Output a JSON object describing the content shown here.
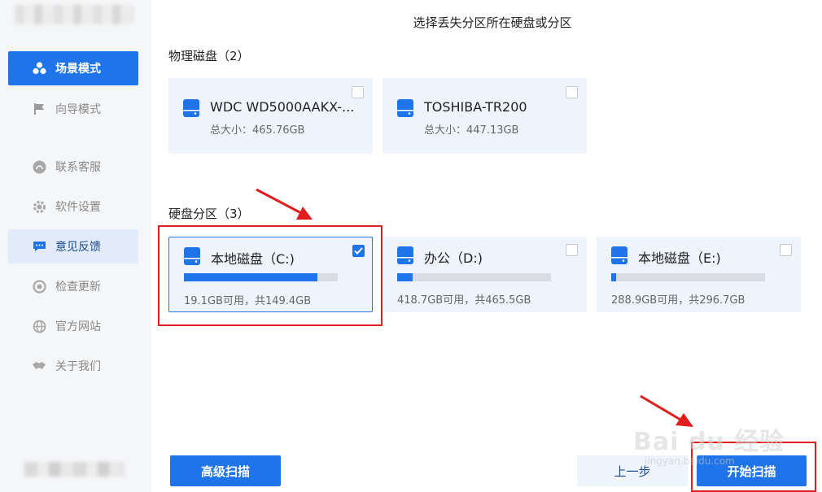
{
  "sidebar": {
    "items": [
      {
        "label": "场景模式",
        "icon": "scene-icon"
      },
      {
        "label": "向导模式",
        "icon": "flag-icon"
      },
      {
        "label": "联系客服",
        "icon": "headset-icon"
      },
      {
        "label": "软件设置",
        "icon": "gear-icon"
      },
      {
        "label": "意见反馈",
        "icon": "chat-icon"
      },
      {
        "label": "检查更新",
        "icon": "update-icon"
      },
      {
        "label": "官方网站",
        "icon": "globe-icon"
      },
      {
        "label": "关于我们",
        "icon": "handshake-icon"
      }
    ]
  },
  "main": {
    "title": "选择丢失分区所在硬盘或分区",
    "physical_section": "物理磁盘（2）",
    "physical_disks": [
      {
        "name": "WDC WD5000AAKX-...",
        "size": "总大小：465.76GB",
        "checked": false
      },
      {
        "name": "TOSHIBA-TR200",
        "size": "总大小：447.13GB",
        "checked": false
      }
    ],
    "partition_section": "硬盘分区（3）",
    "partitions": [
      {
        "name": "本地磁盘（C:)",
        "usage": "19.1GB可用，共149.4GB",
        "used_fraction": 0.87,
        "checked": true
      },
      {
        "name": "办公（D:)",
        "usage": "418.7GB可用，共465.5GB",
        "used_fraction": 0.1,
        "checked": false
      },
      {
        "name": "本地磁盘（E:)",
        "usage": "288.9GB可用，共296.7GB",
        "used_fraction": 0.03,
        "checked": false
      }
    ]
  },
  "footer": {
    "advanced_scan": "高级扫描",
    "prev_step": "上一步",
    "start_scan": "开始扫描"
  },
  "watermark": {
    "brand": "Bai du 经验",
    "url": "jingyan.baidu.com"
  },
  "colors": {
    "accent": "#1e74e8",
    "annotation_red": "#e01e1e",
    "card_bg": "#eef4fc"
  }
}
